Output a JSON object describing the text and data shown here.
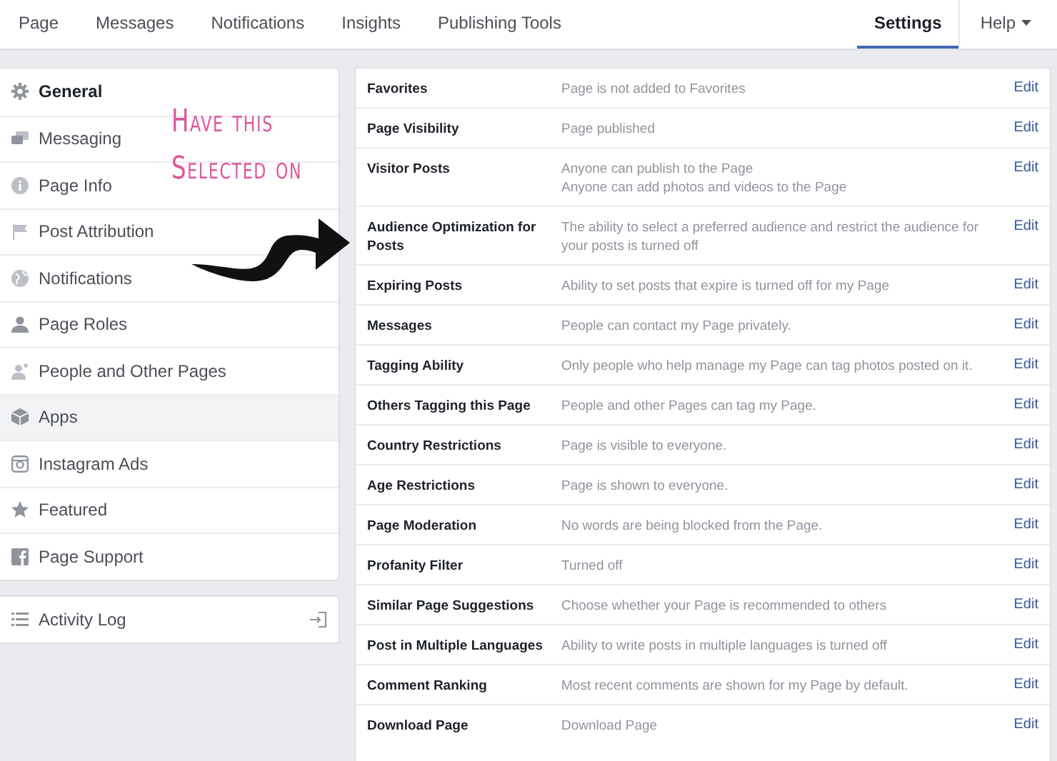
{
  "nav": {
    "tabs": [
      {
        "label": "Page",
        "selected": false
      },
      {
        "label": "Messages",
        "selected": false
      },
      {
        "label": "Notifications",
        "selected": false
      },
      {
        "label": "Insights",
        "selected": false
      },
      {
        "label": "Publishing Tools",
        "selected": false
      }
    ],
    "settings": {
      "label": "Settings",
      "selected": true
    },
    "help": {
      "label": "Help"
    }
  },
  "sidebar": {
    "items": [
      {
        "label": "General",
        "selected": true,
        "hovered": false
      },
      {
        "label": "Messaging",
        "selected": false,
        "hovered": false
      },
      {
        "label": "Page Info",
        "selected": false,
        "hovered": false
      },
      {
        "label": "Post Attribution",
        "selected": false,
        "hovered": false
      },
      {
        "label": "Notifications",
        "selected": false,
        "hovered": false
      },
      {
        "label": "Page Roles",
        "selected": false,
        "hovered": false
      },
      {
        "label": "People and Other Pages",
        "selected": false,
        "hovered": false
      },
      {
        "label": "Apps",
        "selected": false,
        "hovered": true
      },
      {
        "label": "Instagram Ads",
        "selected": false,
        "hovered": false
      },
      {
        "label": "Featured",
        "selected": false,
        "hovered": false
      },
      {
        "label": "Page Support",
        "selected": false,
        "hovered": false
      }
    ],
    "activity_log": {
      "label": "Activity Log"
    }
  },
  "annotation": {
    "lines": [
      "Have this",
      "Selected on"
    ]
  },
  "settings": {
    "rows": [
      {
        "name": "Favorites",
        "value": [
          "Page is not added to Favorites"
        ],
        "action": "Edit"
      },
      {
        "name": "Page Visibility",
        "value": [
          "Page published"
        ],
        "action": "Edit"
      },
      {
        "name": "Visitor Posts",
        "value": [
          "Anyone can publish to the Page",
          "Anyone can add photos and videos to the Page"
        ],
        "action": "Edit"
      },
      {
        "name": "Audience Optimization for Posts",
        "value": [
          "The ability to select a preferred audience and restrict the audience for your posts is turned off"
        ],
        "action": "Edit"
      },
      {
        "name": "Expiring Posts",
        "value": [
          "Ability to set posts that expire is turned off for my Page"
        ],
        "action": "Edit"
      },
      {
        "name": "Messages",
        "value": [
          "People can contact my Page privately."
        ],
        "action": "Edit"
      },
      {
        "name": "Tagging Ability",
        "value": [
          "Only people who help manage my Page can tag photos posted on it."
        ],
        "action": "Edit"
      },
      {
        "name": "Others Tagging this Page",
        "value": [
          "People and other Pages can tag my Page."
        ],
        "action": "Edit"
      },
      {
        "name": "Country Restrictions",
        "value": [
          "Page is visible to everyone."
        ],
        "action": "Edit"
      },
      {
        "name": "Age Restrictions",
        "value": [
          "Page is shown to everyone."
        ],
        "action": "Edit"
      },
      {
        "name": "Page Moderation",
        "value": [
          "No words are being blocked from the Page."
        ],
        "action": "Edit"
      },
      {
        "name": "Profanity Filter",
        "value": [
          "Turned off"
        ],
        "action": "Edit"
      },
      {
        "name": "Similar Page Suggestions",
        "value": [
          "Choose whether your Page is recommended to others"
        ],
        "action": "Edit"
      },
      {
        "name": "Post in Multiple Languages",
        "value": [
          "Ability to write posts in multiple languages is turned off"
        ],
        "action": "Edit"
      },
      {
        "name": "Comment Ranking",
        "value": [
          "Most recent comments are shown for my Page by default."
        ],
        "action": "Edit"
      },
      {
        "name": "Download Page",
        "value": [
          "Download Page"
        ],
        "action": "Edit"
      }
    ]
  }
}
